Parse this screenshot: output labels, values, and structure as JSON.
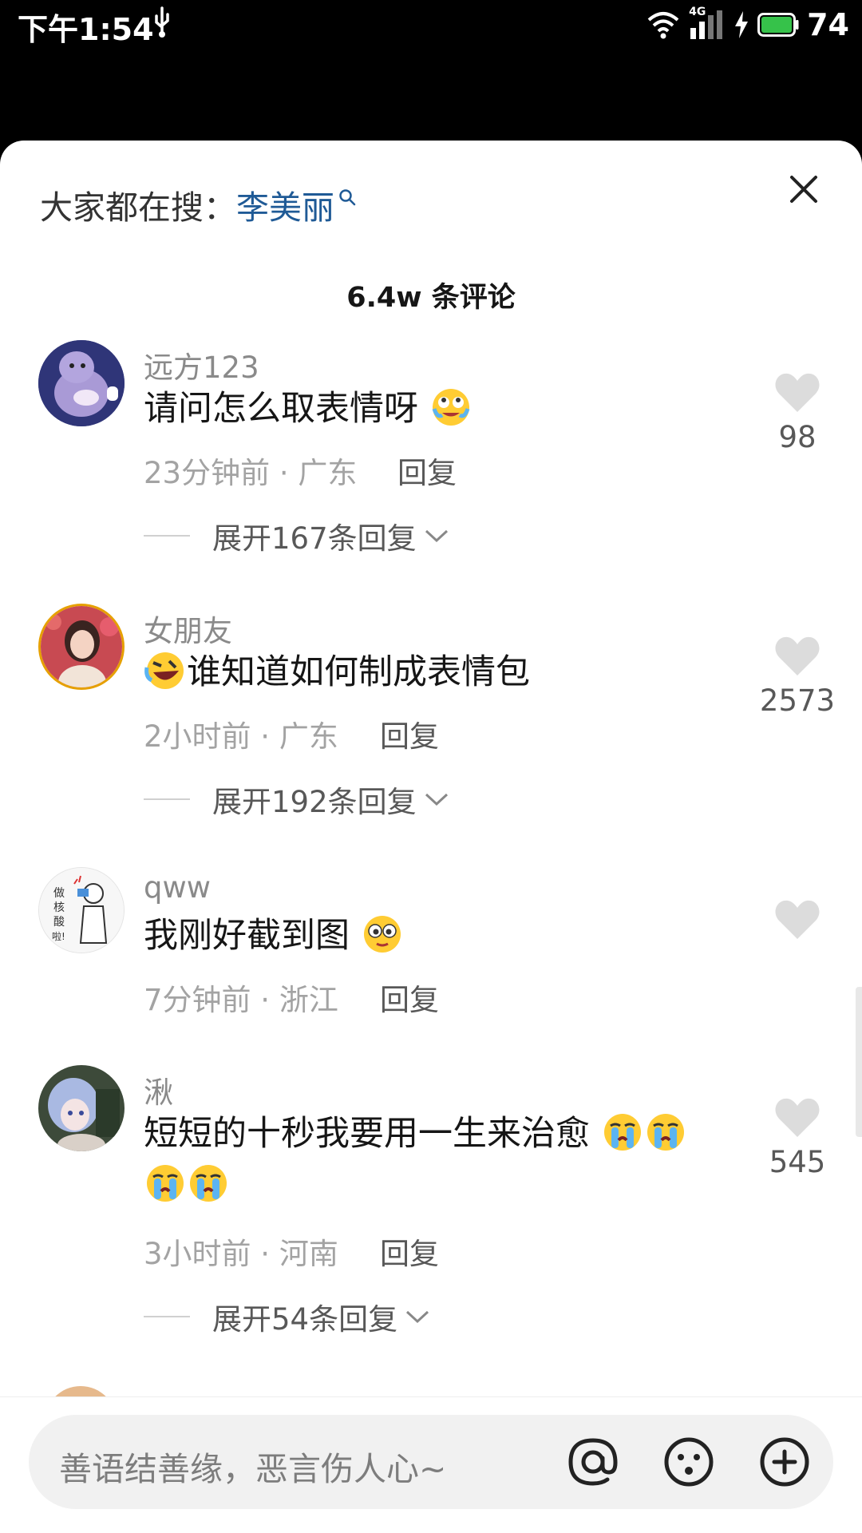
{
  "status_bar": {
    "time": "下午1:54",
    "network": "4G",
    "battery": "74"
  },
  "header": {
    "search_prefix": "大家都在搜：",
    "search_term": "李美丽"
  },
  "comment_count": "6.4w 条评论",
  "comments": [
    {
      "username": "远方123",
      "text": "请问怎么取表情呀",
      "time": "23分钟前",
      "location": "广东",
      "reply_label": "回复",
      "expand_label": "展开167条回复",
      "likes": "98"
    },
    {
      "username": "女朋友",
      "text": "谁知道如何制成表情包",
      "time": "2小时前",
      "location": "广东",
      "reply_label": "回复",
      "expand_label": "展开192条回复",
      "likes": "2573"
    },
    {
      "username": "qww",
      "text": "我刚好截到图",
      "time": "7分钟前",
      "location": "浙江",
      "reply_label": "回复",
      "likes": ""
    },
    {
      "username": "湫",
      "text": "短短的十秒我要用一生来治愈",
      "time": "3小时前",
      "location": "河南",
      "reply_label": "回复",
      "expand_label": "展开54条回复",
      "likes": "545"
    }
  ],
  "input": {
    "placeholder": "善语结善缘，恶言伤人心~"
  },
  "colors": {
    "link": "#1f5a96",
    "heart": "#dcdcdc"
  }
}
